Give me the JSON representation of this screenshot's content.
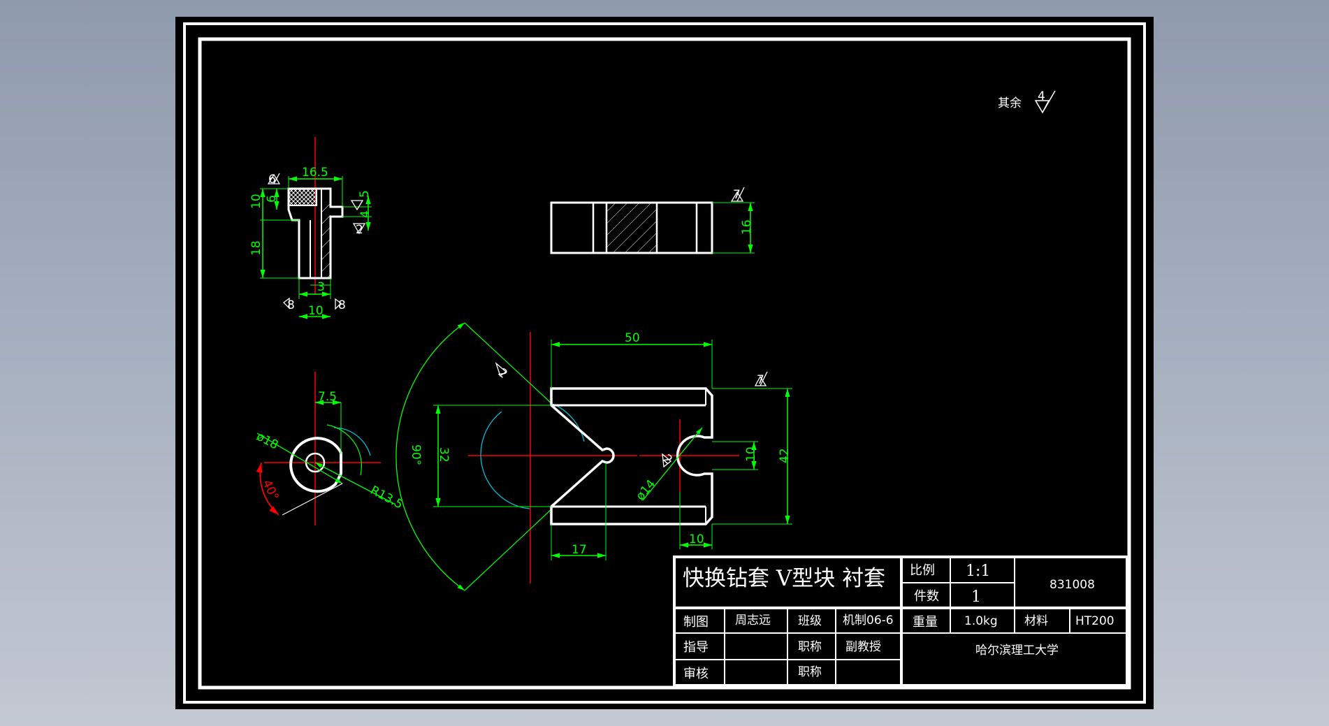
{
  "colors": {
    "background": "#000000",
    "outline": "#ffffff",
    "dimension": "#00ff00",
    "center_line": "#ff0000",
    "arc": "#00bcd4"
  },
  "note": {
    "rest_label": "其余",
    "rest_roughness": "4"
  },
  "bushing_view": {
    "dim_top": "16.5",
    "dim_left_outer": "10",
    "dim_left_inner": "6",
    "dim_height": "18",
    "dim_right_upper": "5",
    "dim_right_lower": "4",
    "dim_bottom_inner": "3",
    "dim_bottom": "10",
    "roughness_top": "6",
    "roughness_bottom_left": "8",
    "roughness_bottom_right": "8",
    "roughness_mid": "2"
  },
  "side_view": {
    "dim_height": "16",
    "roughness": "7"
  },
  "circle_view": {
    "dim_width": "7.5",
    "dim_dia": "ø18",
    "dim_angle": "40°",
    "dim_radius": "R13.5"
  },
  "main_view": {
    "dim_width": "50",
    "dim_arc": "90°",
    "dim_vopen": "32",
    "dim_bottom_left": "17",
    "dim_bottom_right": "10",
    "dim_hole": "ø14",
    "dim_slot": "10",
    "dim_height": "42",
    "roughness_top": "7",
    "roughness_v": "2",
    "roughness_hole": "2"
  },
  "title_block": {
    "title": "快换钻套 V型块 衬套",
    "scale_label": "比例",
    "scale_value": "1:1",
    "qty_label": "件数",
    "qty_value": "1",
    "drawing_no": "831008",
    "drawn_label": "制图",
    "drawn_name": "周志远",
    "class_label": "班级",
    "class_value": "机制06-6",
    "weight_label": "重量",
    "weight_value": "1.0kg",
    "material_label": "材料",
    "material_value": "HT200",
    "guide_label": "指导",
    "title_label_1": "职称",
    "guide_title": "副教授",
    "review_label": "审核",
    "title_label_2": "职称",
    "school": "哈尔滨理工大学"
  }
}
